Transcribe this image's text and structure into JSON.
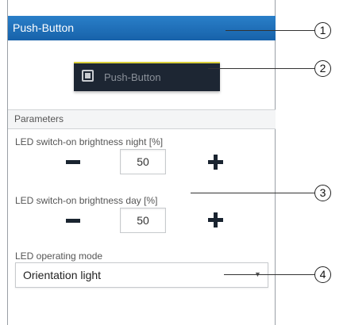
{
  "header": {
    "title": "Push-Button"
  },
  "push_button": {
    "label": "Push-Button",
    "icon": "square-icon",
    "border_accent": "#d9cf3a"
  },
  "parameters": {
    "section_title": "Parameters",
    "night": {
      "label": "LED switch-on brightness night [%]",
      "value": "50"
    },
    "day": {
      "label": "LED switch-on brightness day [%]",
      "value": "50"
    },
    "mode": {
      "label": "LED operating mode",
      "value": "Orientation light",
      "arrow": "▼"
    }
  },
  "callouts": [
    "1",
    "2",
    "3",
    "4"
  ],
  "colors": {
    "header": "#1f6fb8",
    "button": "#1d2633",
    "dark_control": "#1a2430"
  }
}
